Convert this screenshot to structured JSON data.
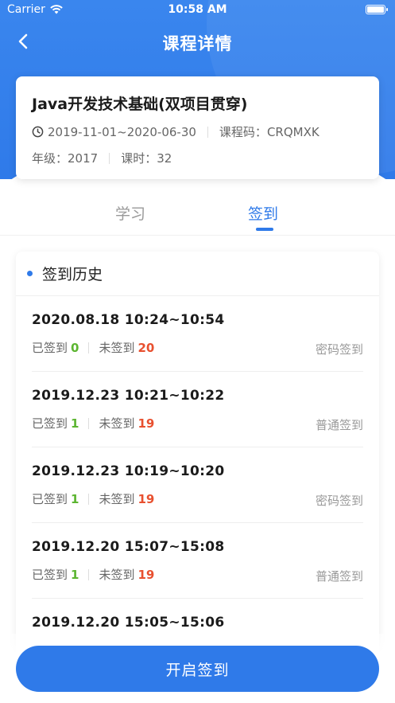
{
  "status_bar": {
    "carrier": "Carrier",
    "time": "10:58 AM"
  },
  "nav": {
    "title": "课程详情"
  },
  "course": {
    "name": "Java开发技术基础(双项目贯穿)",
    "date_range": "2019-11-01~2020-06-30",
    "code_label": "课程码：",
    "code": "CRQMXK",
    "grade_label": "年级：",
    "grade": "2017",
    "hours_label": "课时：",
    "hours": "32"
  },
  "tabs": {
    "study": "学习",
    "signin": "签到"
  },
  "history": {
    "title": "签到历史",
    "signed_label": "已签到",
    "unsigned_label": "未签到",
    "records": [
      {
        "when": "2020.08.18  10:24~10:54",
        "signed": "0",
        "unsigned": "20",
        "method": "密码签到"
      },
      {
        "when": "2019.12.23  10:21~10:22",
        "signed": "1",
        "unsigned": "19",
        "method": "普通签到"
      },
      {
        "when": "2019.12.23  10:19~10:20",
        "signed": "1",
        "unsigned": "19",
        "method": "密码签到"
      },
      {
        "when": "2019.12.20  15:07~15:08",
        "signed": "1",
        "unsigned": "19",
        "method": "普通签到"
      },
      {
        "when": "2019.12.20  15:05~15:06",
        "signed": "",
        "unsigned": "",
        "method": ""
      }
    ]
  },
  "start_button": "开启签到",
  "colors": {
    "primary": "#2f7ae9",
    "green": "#5cb531",
    "red": "#e8502f"
  }
}
